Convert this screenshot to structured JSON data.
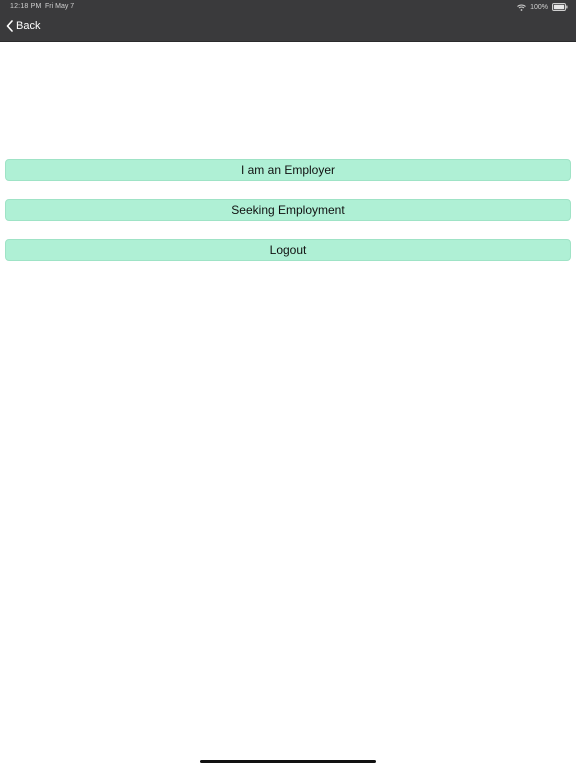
{
  "status_bar": {
    "time": "12:18 PM",
    "date": "Fri May 7",
    "battery": "100%",
    "wifi_icon": "wifi-icon",
    "battery_icon": "battery-icon"
  },
  "nav": {
    "back_label": "Back",
    "back_icon": "chevron-left-icon"
  },
  "menu": {
    "employer_label": "I am an Employer",
    "seeking_label": "Seeking Employment",
    "logout_label": "Logout"
  },
  "colors": {
    "topbar": "#3a3a3c",
    "button_fill": "#aff0d5",
    "button_border": "#9fe3c6"
  }
}
